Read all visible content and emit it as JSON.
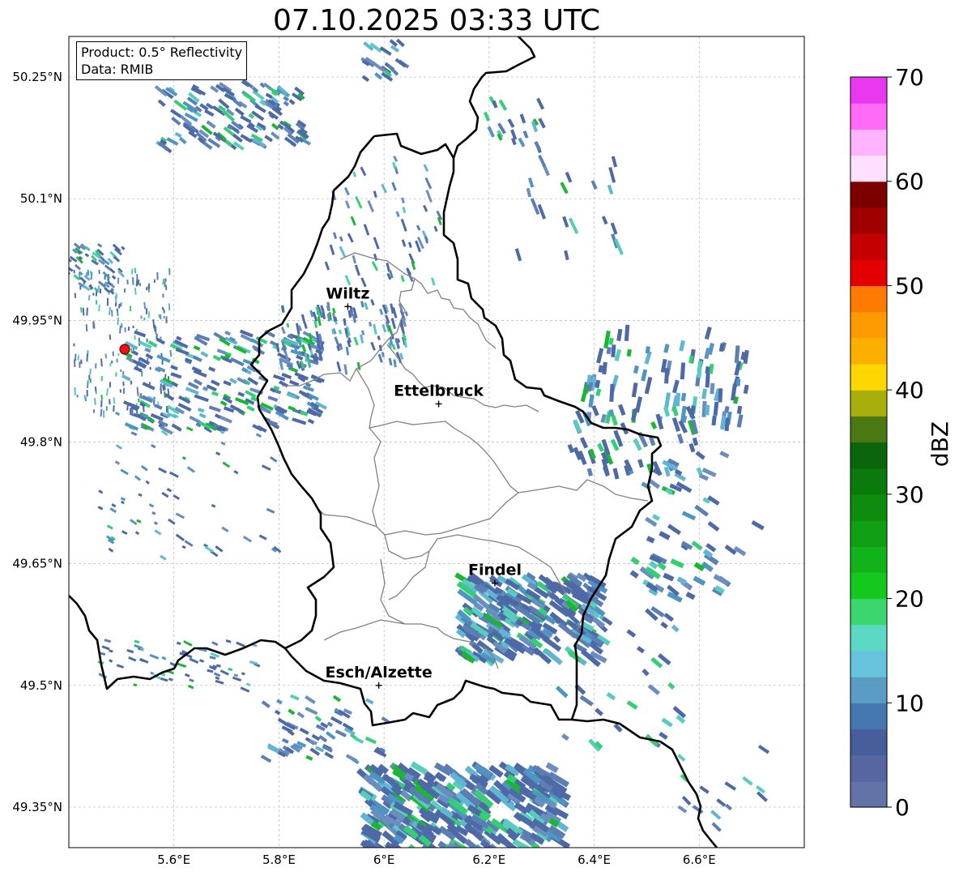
{
  "title": "07.10.2025 03:33 UTC",
  "info": {
    "product": "Product: 0.5° Reflectivity",
    "data": "Data: RMIB"
  },
  "map": {
    "lon_range": [
      5.4,
      6.8
    ],
    "lat_range": [
      49.3,
      50.3
    ],
    "lon_ticks": [
      {
        "value": 5.6,
        "label": "5.6°E"
      },
      {
        "value": 5.8,
        "label": "5.8°E"
      },
      {
        "value": 6.0,
        "label": "6°E"
      },
      {
        "value": 6.2,
        "label": "6.2°E"
      },
      {
        "value": 6.4,
        "label": "6.4°E"
      },
      {
        "value": 6.6,
        "label": "6.6°E"
      }
    ],
    "lat_ticks": [
      {
        "value": 50.25,
        "label": "50.25°N"
      },
      {
        "value": 50.1,
        "label": "50.1°N"
      },
      {
        "value": 49.95,
        "label": "49.95°N"
      },
      {
        "value": 49.8,
        "label": "49.8°N"
      },
      {
        "value": 49.65,
        "label": "49.65°N"
      },
      {
        "value": 49.5,
        "label": "49.5°N"
      },
      {
        "value": 49.35,
        "label": "49.35°N"
      }
    ],
    "radar_site": {
      "lon": 5.505,
      "lat": 49.915
    },
    "cities": [
      {
        "name": "Wiltz",
        "lon": 5.931,
        "lat": 49.967
      },
      {
        "name": "Ettelbruck",
        "lon": 6.104,
        "lat": 49.847
      },
      {
        "name": "Findel",
        "lon": 6.211,
        "lat": 49.626
      },
      {
        "name": "Esch/Alzette",
        "lon": 5.99,
        "lat": 49.5
      }
    ]
  },
  "colorbar": {
    "label": "dBZ",
    "min": 0,
    "max": 70,
    "ticks": [
      {
        "value": 0,
        "label": "0"
      },
      {
        "value": 10,
        "label": "10"
      },
      {
        "value": 20,
        "label": "20"
      },
      {
        "value": 30,
        "label": "30"
      },
      {
        "value": 40,
        "label": "40"
      },
      {
        "value": 50,
        "label": "50"
      },
      {
        "value": 60,
        "label": "60"
      },
      {
        "value": 70,
        "label": "70"
      }
    ],
    "colors": [
      "#6273a8",
      "#5566a0",
      "#465e9c",
      "#4578b0",
      "#5a9cc4",
      "#66c3dc",
      "#5bd9c4",
      "#3cd66e",
      "#14c81e",
      "#12b31a",
      "#109f14",
      "#0e8c10",
      "#0b7a0d",
      "#0b650b",
      "#4a7812",
      "#a8ae0a",
      "#ffd700",
      "#fbb000",
      "#ff9a00",
      "#ff7a00",
      "#e40000",
      "#c40000",
      "#a00000",
      "#7d0000",
      "#ffe0ff",
      "#ffb3ff",
      "#ff6af7",
      "#ea38f0"
    ]
  },
  "radar_palette": [
    "#4e6aa6",
    "#5b7fb5",
    "#6a8ec0",
    "#4f95c4",
    "#60b6d2",
    "#58cdbc",
    "#34cf72",
    "#1ab831"
  ]
}
